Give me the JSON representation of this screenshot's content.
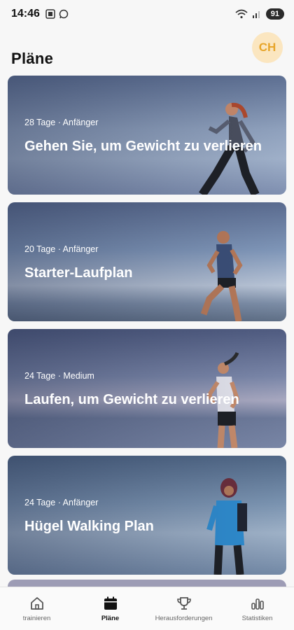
{
  "status_bar": {
    "time": "14:46",
    "battery": "91"
  },
  "header": {
    "title": "Pläne",
    "avatar_initials": "CH"
  },
  "plans": [
    {
      "meta": "28 Tage · Anfänger",
      "title": "Gehen Sie, um Gewicht zu verlieren"
    },
    {
      "meta": "20 Tage · Anfänger",
      "title": "Starter-Laufplan"
    },
    {
      "meta": "24 Tage · Medium",
      "title": "Laufen, um Gewicht zu verlieren"
    },
    {
      "meta": "24 Tage · Anfänger",
      "title": "Hügel Walking Plan"
    }
  ],
  "bottom_nav": [
    {
      "label": "trainieren",
      "icon": "home-icon",
      "active": false
    },
    {
      "label": "Pläne",
      "icon": "calendar-icon",
      "active": true
    },
    {
      "label": "Herausforderungen",
      "icon": "trophy-icon",
      "active": false
    },
    {
      "label": "Statistiken",
      "icon": "bar-chart-icon",
      "active": false
    }
  ]
}
